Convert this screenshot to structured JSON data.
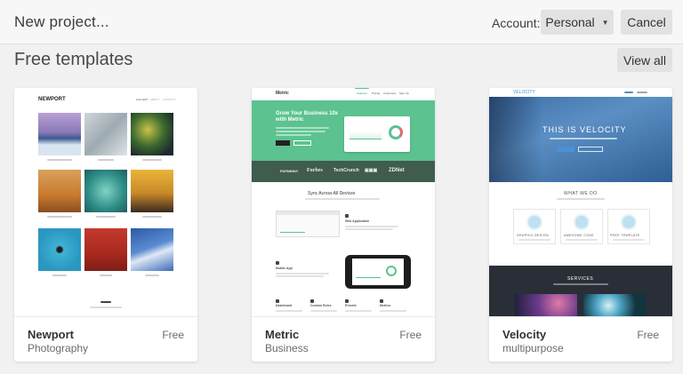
{
  "header": {
    "title": "New project...",
    "account_label": "Account:",
    "account_value": "Personal",
    "cancel_label": "Cancel"
  },
  "section": {
    "title": "Free templates",
    "view_all_label": "View all"
  },
  "templates": [
    {
      "name": "Newport",
      "category": "Photography",
      "price": "Free",
      "preview": {
        "logo": "NEWPORT",
        "nav": [
          "GALLERY",
          "ABOUT",
          "CONTACT"
        ]
      }
    },
    {
      "name": "Metric",
      "category": "Business",
      "price": "Free",
      "preview": {
        "logo": "Metric",
        "nav": [
          "Features",
          "Pricing",
          "Customers",
          "Sign Up"
        ],
        "hero_title": "Grow Your Business 10x with Metric",
        "logos": [
          "PAYMINNY",
          "Forbes",
          "TechCrunch",
          "ZDNet"
        ],
        "section_title": "Sync Across All Devices",
        "feature_1": "Web Application",
        "feature_2": "Mobile App",
        "bottom_features": [
          "Dashboard",
          "Custom Rules",
          "Presets",
          "Metrics"
        ]
      }
    },
    {
      "name": "Velocity",
      "category": "multipurpose",
      "price": "Free",
      "preview": {
        "logo": "VELOCITY",
        "hero_title": "THIS IS VELOCITY",
        "what_we_do": "WHAT WE DO",
        "features": [
          "GRAPHIC DESIGN",
          "AWESOME CODE",
          "FREE TEMPLATE"
        ],
        "services": "SERVICES"
      }
    }
  ],
  "colors": {
    "page_bg": "#f1f1f1",
    "button_bg": "#e2e2e2",
    "metric_green": "#5cc28f",
    "velocity_blue": "#3e6fa6"
  }
}
